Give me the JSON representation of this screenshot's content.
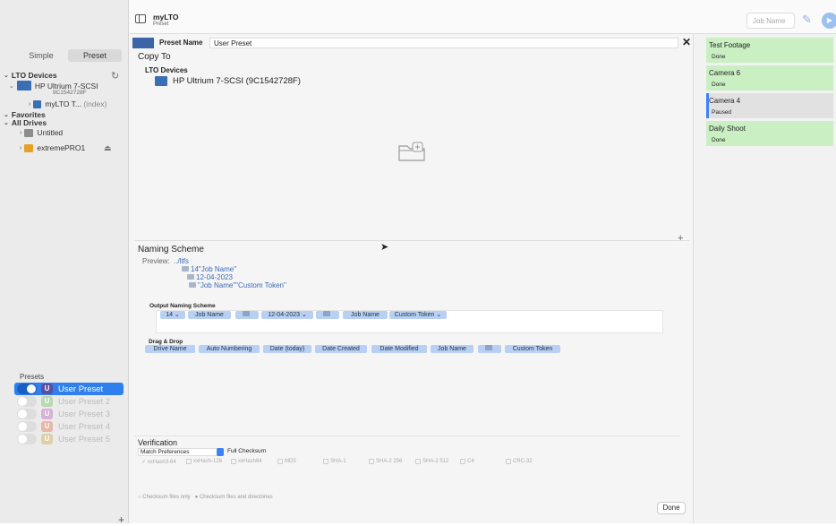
{
  "app": {
    "title": "myLTO",
    "subtitle": "Preset"
  },
  "toolbar": {
    "job_name_placeholder": "Job Name"
  },
  "sidebar": {
    "tabs": [
      "Simple",
      "Preset"
    ],
    "tree": {
      "lto_devices": "LTO Devices",
      "device_name": "HP Ultrium 7-SCSI",
      "device_serial": "9C1542728F",
      "tape_name": "myLTO T...",
      "tape_suffix": "(index)",
      "favorites": "Favorites",
      "all_drives": "All Drives",
      "drive1": "Untitled",
      "drive2": "extremePRO1"
    },
    "presets_header": "Presets",
    "presets": [
      {
        "badge": "U",
        "name": "User Preset",
        "selected": true
      },
      {
        "badge": "U",
        "name": "User Preset 2",
        "selected": false
      },
      {
        "badge": "U",
        "name": "User Preset 3",
        "selected": false
      },
      {
        "badge": "U",
        "name": "User Preset 4",
        "selected": false
      },
      {
        "badge": "U",
        "name": "User Preset 5",
        "selected": false
      }
    ]
  },
  "main": {
    "preset_name_label": "Preset Name",
    "preset_name_value": "User Preset",
    "copy_to": "Copy To",
    "lto_devices": "LTO Devices",
    "lto_device": "HP Ultrium 7-SCSI (9C1542728F)",
    "naming_scheme": "Naming Scheme",
    "preview_label": "Preview:",
    "preview_lines": [
      "../ltfs",
      "14\"Job Name\"",
      "12-04-2023",
      "\"Job Name\"\"Custom Token\""
    ],
    "output_naming_scheme": "Output Naming Scheme",
    "output_tokens": [
      "14 ⌄",
      "Job Name",
      "",
      "12-04-2023 ⌄",
      "",
      "Job Name",
      "Custom Token ⌄"
    ],
    "drag_drop": "Drag & Drop",
    "drag_tokens": [
      "Drive Name",
      "Auto Numbering",
      "Date (today)",
      "Date Created",
      "Date Modified",
      "Job Name",
      "",
      "Custom Token"
    ],
    "verification": "Verification",
    "match_prefs": "Match Preferences",
    "full_checksum": "Full Checksum",
    "algorithms": [
      "✓ xxHash3-64",
      "xxHash-128",
      "xxHash64",
      "MD5",
      "SHA-1",
      "SHA-2 256",
      "SHA-2 512",
      "C4",
      "CRC-32"
    ],
    "checksum_files_only": "Checksum files only",
    "checksum_files_dirs": "Checksum files and directories",
    "done": "Done"
  },
  "queue": [
    {
      "title": "Test Footage",
      "status": "Done"
    },
    {
      "title": "Camera 6",
      "status": "Done"
    },
    {
      "title": "Camera 4",
      "status": "Paused"
    },
    {
      "title": "Daily Shoot",
      "status": "Done"
    }
  ],
  "colors": {
    "accent": "#2f80ed",
    "job_done": "#c9efc3",
    "job_paused": "#e1e1e1",
    "token": "#b8d0f4"
  }
}
